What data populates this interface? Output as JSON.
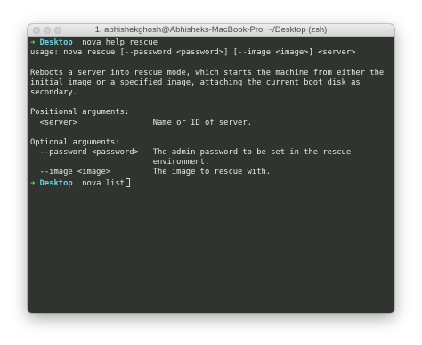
{
  "window": {
    "title": "1. abhishekghosh@Abhisheks-MacBook-Pro: ~/Desktop (zsh)"
  },
  "terminal": {
    "prompt1": {
      "arrow": "➜",
      "dir": "Desktop",
      "command": "nova help rescue"
    },
    "output": [
      "usage: nova rescue [--password <password>] [--image <image>] <server>",
      "",
      "Reboots a server into rescue mode, which starts the machine from either the",
      "initial image or a specified image, attaching the current boot disk as",
      "secondary.",
      "",
      "Positional arguments:",
      "  <server>                Name or ID of server.",
      "",
      "Optional arguments:",
      "  --password <password>   The admin password to be set in the rescue",
      "                          environment.",
      "  --image <image>         The image to rescue with."
    ],
    "prompt2": {
      "arrow": "➜",
      "dir": "Desktop",
      "command": "nova list"
    }
  },
  "colors": {
    "terminal_background": "#2f352e",
    "prompt_arrow": "#6fdc6a",
    "prompt_dir": "#6ecfe1",
    "text": "#e7e7e7"
  }
}
